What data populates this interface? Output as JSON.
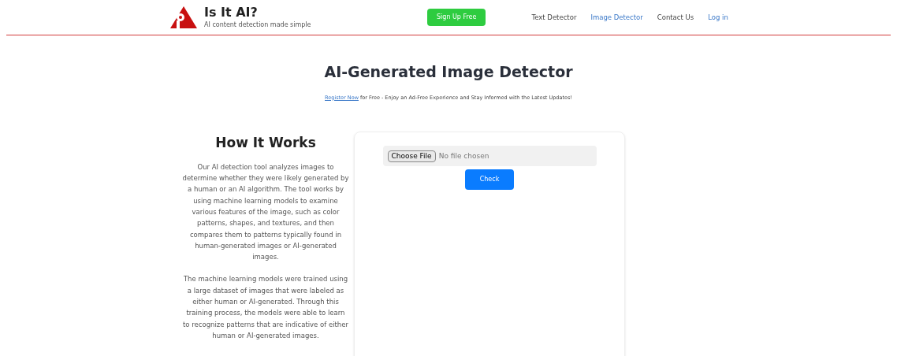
{
  "header": {
    "brand": "Is It AI?",
    "tagline": "AI content detection made simple",
    "signup": "Sign Up Free",
    "nav": [
      {
        "label": "Text Detector",
        "selected": false
      },
      {
        "label": "Image Detector",
        "selected": true
      },
      {
        "label": "Contact Us",
        "selected": false
      }
    ],
    "login": "Log in"
  },
  "title": "AI-Generated Image Detector",
  "notice": {
    "link": "Register Now",
    "text": " for Free - Enjoy an Ad-Free Experience and Stay Informed with the Latest Updates!"
  },
  "how": {
    "heading": "How It Works",
    "paragraphs": [
      "Our AI detection tool analyzes images to determine whether they were likely generated by a human or an AI algorithm. The tool works by using machine learning models to examine various features of the image, such as color patterns, shapes, and textures, and then compares them to patterns typically found in human-generated images or AI-generated images.",
      "The machine learning models were trained using a large dataset of images that were labeled as either human or AI-generated. Through this training process, the models were able to learn to recognize patterns that are indicative of either human or AI-generated images."
    ]
  },
  "upload": {
    "choose": "Choose File",
    "status": "No file chosen",
    "check": "Check"
  }
}
